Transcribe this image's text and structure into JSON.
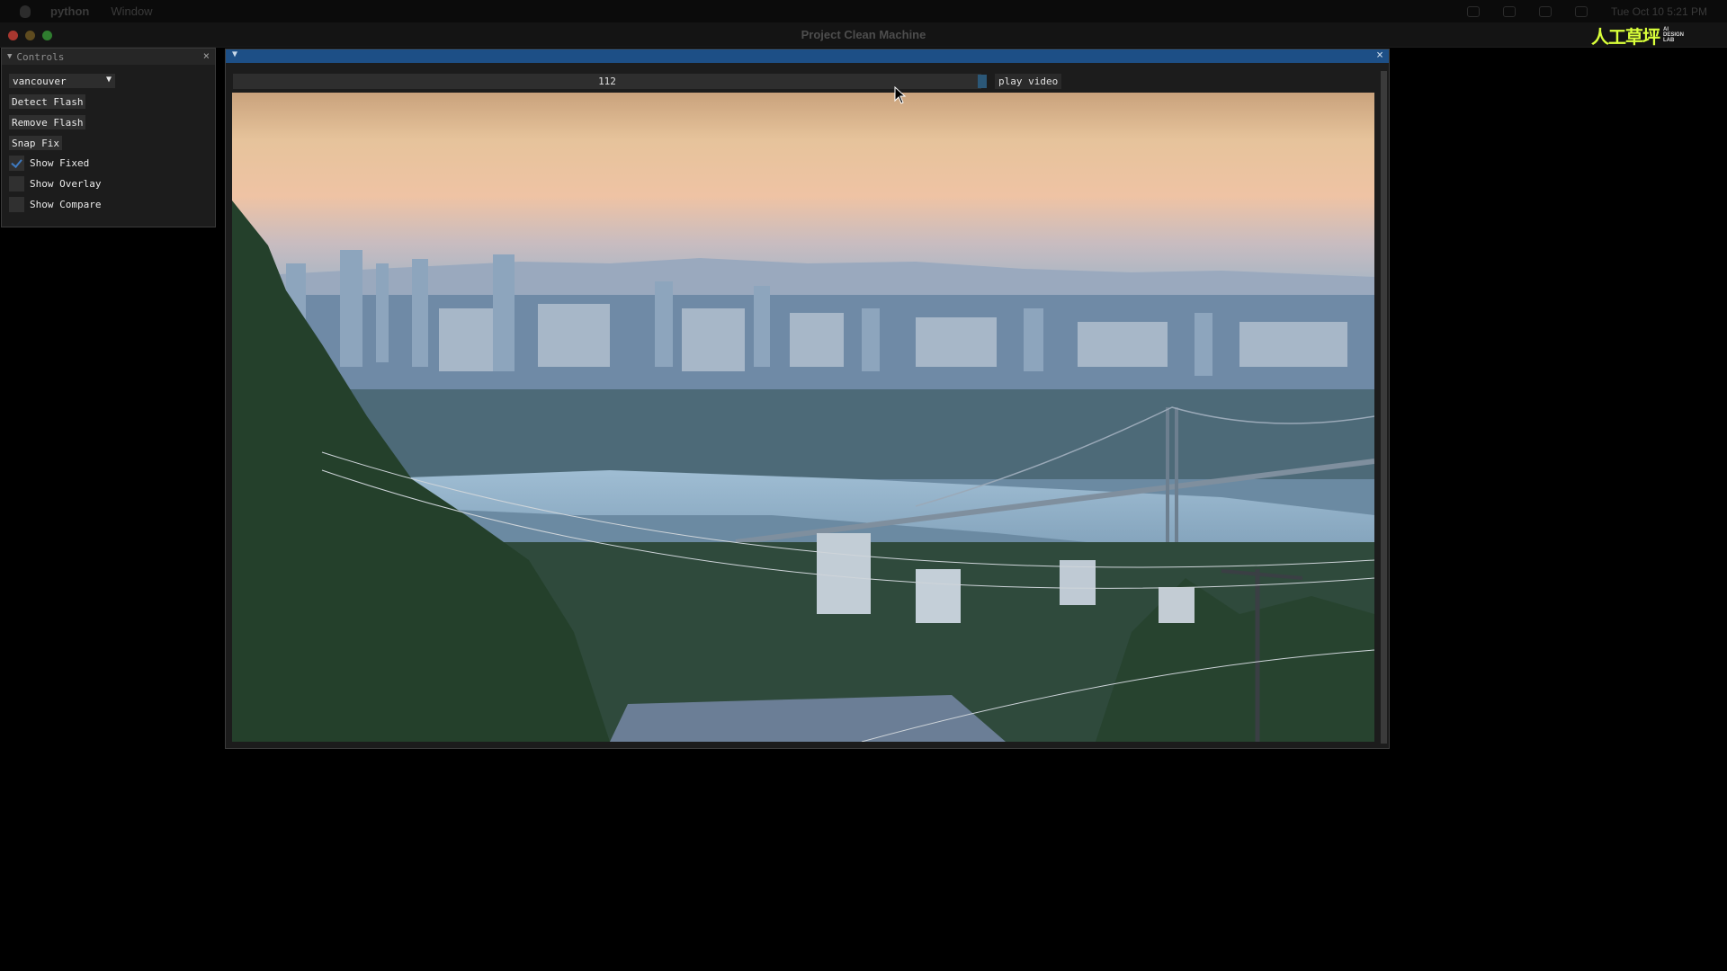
{
  "menubar": {
    "app_name": "python",
    "menu_window": "Window",
    "clock": "Tue Oct 10  5:21 PM"
  },
  "titlebar": {
    "title": "Project Clean Machine",
    "brand_mark": "人工草坪",
    "brand_tag": [
      "AI",
      "DESIGN",
      "LAB"
    ]
  },
  "controls": {
    "title": "Controls",
    "close_glyph": "×",
    "collapse_glyph": "▼",
    "dataset_selected": "vancouver",
    "dropdown_glyph": "▼",
    "buttons": {
      "detect_flash": "Detect Flash",
      "remove_flash": "Remove Flash",
      "snap_fix": "Snap Fix"
    },
    "checkboxes": {
      "show_fixed": {
        "label": "Show Fixed",
        "checked": true
      },
      "show_overlay": {
        "label": "Show Overlay",
        "checked": false
      },
      "show_compare": {
        "label": "Show Compare",
        "checked": false
      }
    }
  },
  "video_window": {
    "collapse_glyph": "▼",
    "close_glyph": "×",
    "frame_value": "112",
    "play_label": "play video",
    "play_checked": false,
    "accent_color": "#1d4f86"
  }
}
